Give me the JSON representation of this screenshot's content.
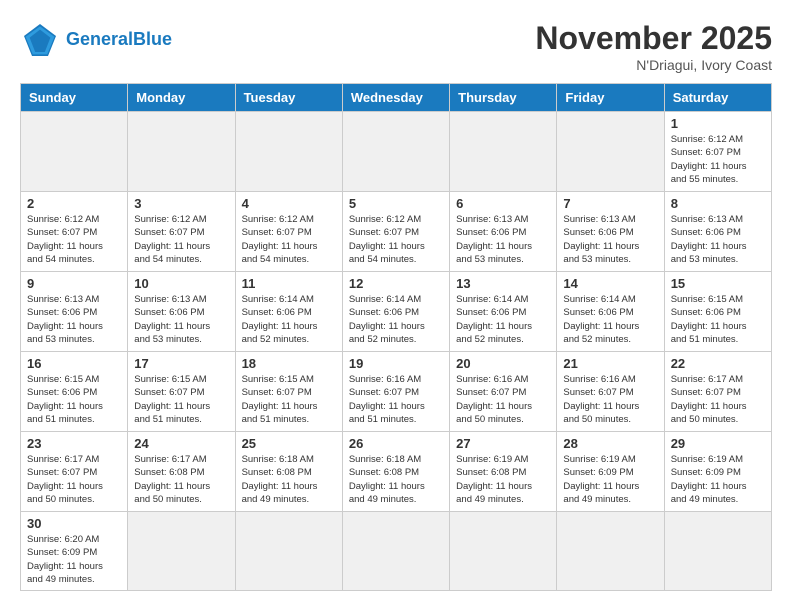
{
  "header": {
    "logo_general": "General",
    "logo_blue": "Blue",
    "month_year": "November 2025",
    "location": "N'Driagui, Ivory Coast"
  },
  "days_of_week": [
    "Sunday",
    "Monday",
    "Tuesday",
    "Wednesday",
    "Thursday",
    "Friday",
    "Saturday"
  ],
  "weeks": [
    [
      {
        "day": "",
        "empty": true
      },
      {
        "day": "",
        "empty": true
      },
      {
        "day": "",
        "empty": true
      },
      {
        "day": "",
        "empty": true
      },
      {
        "day": "",
        "empty": true
      },
      {
        "day": "",
        "empty": true
      },
      {
        "day": "1",
        "sunrise": "Sunrise: 6:12 AM",
        "sunset": "Sunset: 6:07 PM",
        "daylight": "Daylight: 11 hours and 55 minutes."
      }
    ],
    [
      {
        "day": "2",
        "sunrise": "Sunrise: 6:12 AM",
        "sunset": "Sunset: 6:07 PM",
        "daylight": "Daylight: 11 hours and 54 minutes."
      },
      {
        "day": "3",
        "sunrise": "Sunrise: 6:12 AM",
        "sunset": "Sunset: 6:07 PM",
        "daylight": "Daylight: 11 hours and 54 minutes."
      },
      {
        "day": "4",
        "sunrise": "Sunrise: 6:12 AM",
        "sunset": "Sunset: 6:07 PM",
        "daylight": "Daylight: 11 hours and 54 minutes."
      },
      {
        "day": "5",
        "sunrise": "Sunrise: 6:12 AM",
        "sunset": "Sunset: 6:07 PM",
        "daylight": "Daylight: 11 hours and 54 minutes."
      },
      {
        "day": "6",
        "sunrise": "Sunrise: 6:13 AM",
        "sunset": "Sunset: 6:06 PM",
        "daylight": "Daylight: 11 hours and 53 minutes."
      },
      {
        "day": "7",
        "sunrise": "Sunrise: 6:13 AM",
        "sunset": "Sunset: 6:06 PM",
        "daylight": "Daylight: 11 hours and 53 minutes."
      },
      {
        "day": "8",
        "sunrise": "Sunrise: 6:13 AM",
        "sunset": "Sunset: 6:06 PM",
        "daylight": "Daylight: 11 hours and 53 minutes."
      }
    ],
    [
      {
        "day": "9",
        "sunrise": "Sunrise: 6:13 AM",
        "sunset": "Sunset: 6:06 PM",
        "daylight": "Daylight: 11 hours and 53 minutes."
      },
      {
        "day": "10",
        "sunrise": "Sunrise: 6:13 AM",
        "sunset": "Sunset: 6:06 PM",
        "daylight": "Daylight: 11 hours and 53 minutes."
      },
      {
        "day": "11",
        "sunrise": "Sunrise: 6:14 AM",
        "sunset": "Sunset: 6:06 PM",
        "daylight": "Daylight: 11 hours and 52 minutes."
      },
      {
        "day": "12",
        "sunrise": "Sunrise: 6:14 AM",
        "sunset": "Sunset: 6:06 PM",
        "daylight": "Daylight: 11 hours and 52 minutes."
      },
      {
        "day": "13",
        "sunrise": "Sunrise: 6:14 AM",
        "sunset": "Sunset: 6:06 PM",
        "daylight": "Daylight: 11 hours and 52 minutes."
      },
      {
        "day": "14",
        "sunrise": "Sunrise: 6:14 AM",
        "sunset": "Sunset: 6:06 PM",
        "daylight": "Daylight: 11 hours and 52 minutes."
      },
      {
        "day": "15",
        "sunrise": "Sunrise: 6:15 AM",
        "sunset": "Sunset: 6:06 PM",
        "daylight": "Daylight: 11 hours and 51 minutes."
      }
    ],
    [
      {
        "day": "16",
        "sunrise": "Sunrise: 6:15 AM",
        "sunset": "Sunset: 6:06 PM",
        "daylight": "Daylight: 11 hours and 51 minutes."
      },
      {
        "day": "17",
        "sunrise": "Sunrise: 6:15 AM",
        "sunset": "Sunset: 6:07 PM",
        "daylight": "Daylight: 11 hours and 51 minutes."
      },
      {
        "day": "18",
        "sunrise": "Sunrise: 6:15 AM",
        "sunset": "Sunset: 6:07 PM",
        "daylight": "Daylight: 11 hours and 51 minutes."
      },
      {
        "day": "19",
        "sunrise": "Sunrise: 6:16 AM",
        "sunset": "Sunset: 6:07 PM",
        "daylight": "Daylight: 11 hours and 51 minutes."
      },
      {
        "day": "20",
        "sunrise": "Sunrise: 6:16 AM",
        "sunset": "Sunset: 6:07 PM",
        "daylight": "Daylight: 11 hours and 50 minutes."
      },
      {
        "day": "21",
        "sunrise": "Sunrise: 6:16 AM",
        "sunset": "Sunset: 6:07 PM",
        "daylight": "Daylight: 11 hours and 50 minutes."
      },
      {
        "day": "22",
        "sunrise": "Sunrise: 6:17 AM",
        "sunset": "Sunset: 6:07 PM",
        "daylight": "Daylight: 11 hours and 50 minutes."
      }
    ],
    [
      {
        "day": "23",
        "sunrise": "Sunrise: 6:17 AM",
        "sunset": "Sunset: 6:07 PM",
        "daylight": "Daylight: 11 hours and 50 minutes."
      },
      {
        "day": "24",
        "sunrise": "Sunrise: 6:17 AM",
        "sunset": "Sunset: 6:08 PM",
        "daylight": "Daylight: 11 hours and 50 minutes."
      },
      {
        "day": "25",
        "sunrise": "Sunrise: 6:18 AM",
        "sunset": "Sunset: 6:08 PM",
        "daylight": "Daylight: 11 hours and 49 minutes."
      },
      {
        "day": "26",
        "sunrise": "Sunrise: 6:18 AM",
        "sunset": "Sunset: 6:08 PM",
        "daylight": "Daylight: 11 hours and 49 minutes."
      },
      {
        "day": "27",
        "sunrise": "Sunrise: 6:19 AM",
        "sunset": "Sunset: 6:08 PM",
        "daylight": "Daylight: 11 hours and 49 minutes."
      },
      {
        "day": "28",
        "sunrise": "Sunrise: 6:19 AM",
        "sunset": "Sunset: 6:09 PM",
        "daylight": "Daylight: 11 hours and 49 minutes."
      },
      {
        "day": "29",
        "sunrise": "Sunrise: 6:19 AM",
        "sunset": "Sunset: 6:09 PM",
        "daylight": "Daylight: 11 hours and 49 minutes."
      }
    ],
    [
      {
        "day": "30",
        "sunrise": "Sunrise: 6:20 AM",
        "sunset": "Sunset: 6:09 PM",
        "daylight": "Daylight: 11 hours and 49 minutes."
      },
      {
        "day": "",
        "empty": true
      },
      {
        "day": "",
        "empty": true
      },
      {
        "day": "",
        "empty": true
      },
      {
        "day": "",
        "empty": true
      },
      {
        "day": "",
        "empty": true
      },
      {
        "day": "",
        "empty": true
      }
    ]
  ]
}
